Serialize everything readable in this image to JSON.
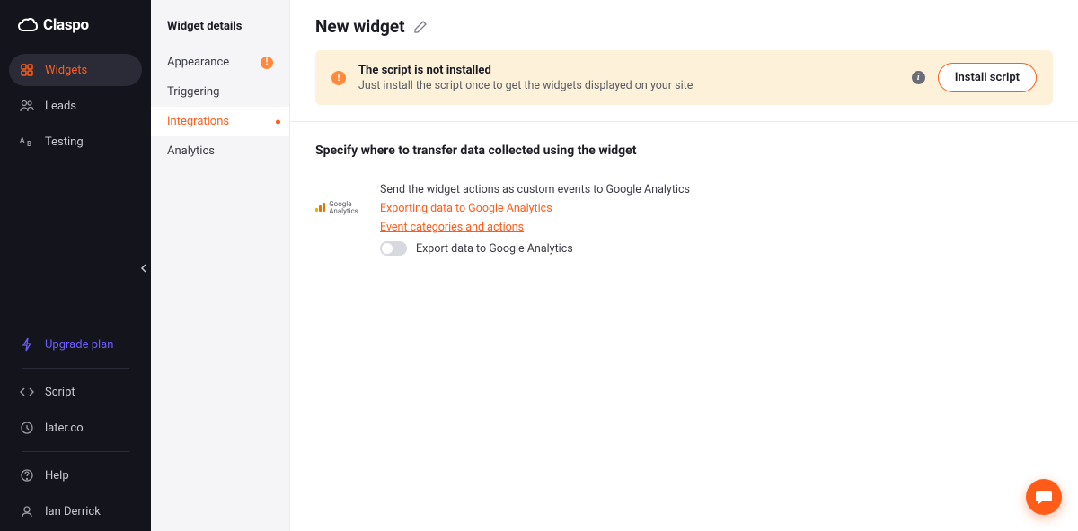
{
  "brand": "Claspo",
  "main_nav": {
    "widgets": "Widgets",
    "leads": "Leads",
    "testing": "Testing",
    "upgrade": "Upgrade plan",
    "script": "Script",
    "domain": "later.co",
    "help": "Help",
    "user": "Ian Derrick"
  },
  "sub_nav": {
    "title": "Widget details",
    "appearance": "Appearance",
    "triggering": "Triggering",
    "integrations": "Integrations",
    "analytics": "Analytics"
  },
  "page": {
    "title": "New widget"
  },
  "alert": {
    "title": "The script is not installed",
    "desc": "Just install the script once to get the widgets displayed on your site",
    "button": "Install script"
  },
  "section": {
    "heading": "Specify where to transfer data collected using the widget"
  },
  "integration": {
    "logo_line1": "Google",
    "logo_line2": "Analytics",
    "desc": "Send the widget actions as custom events to Google Analytics",
    "link1": "Exporting data to Google Analytics",
    "link2": "Event categories and actions",
    "toggle_label": "Export data to Google Analytics"
  }
}
